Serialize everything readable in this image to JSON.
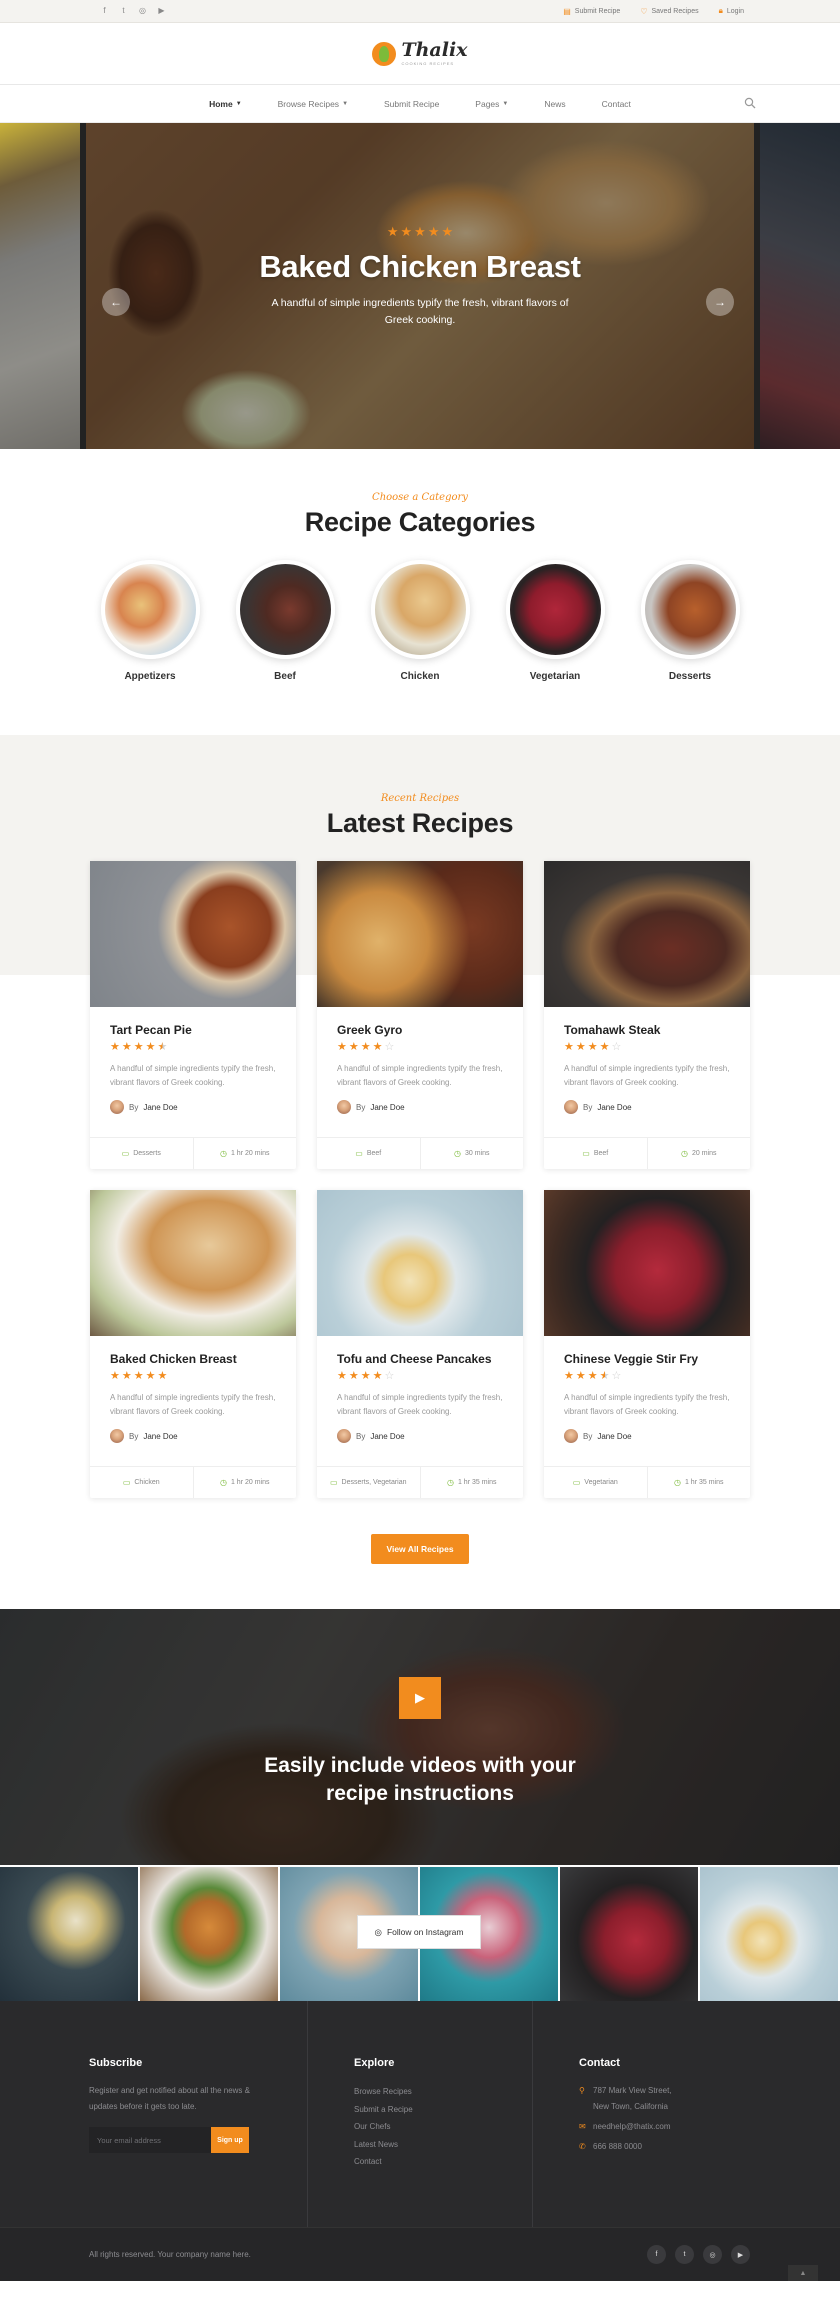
{
  "topbar": {
    "social_icons": [
      "facebook-icon",
      "twitter-icon",
      "instagram-icon",
      "youtube-icon"
    ],
    "submit_recipe": "Submit Recipe",
    "saved_recipes": "Saved Recipes",
    "login": "Login"
  },
  "brand": {
    "name": "Thalix",
    "tagline": "COOKING RECIPES"
  },
  "nav": {
    "items": [
      "Home",
      "Browse Recipes",
      "Submit Recipe",
      "Pages",
      "News",
      "Contact"
    ],
    "active": "Home"
  },
  "hero": {
    "rating": 5,
    "title": "Baked Chicken Breast",
    "description": "A handful of simple ingredients typify the fresh, vibrant flavors of Greek cooking."
  },
  "categories": {
    "eyebrow": "Choose a Category",
    "title": "Recipe Categories",
    "items": [
      {
        "label": "Appetizers"
      },
      {
        "label": "Beef"
      },
      {
        "label": "Chicken"
      },
      {
        "label": "Vegetarian"
      },
      {
        "label": "Desserts"
      }
    ]
  },
  "recipes": {
    "eyebrow": "Recent Recipes",
    "title": "Latest Recipes",
    "by": "By",
    "cards": [
      {
        "title": "Tart Pecan Pie",
        "rating": 4.5,
        "desc": "A handful of simple ingredients typify the fresh, vibrant flavors of Greek cooking.",
        "author": "Jane Doe",
        "category": "Desserts",
        "time": "1 hr 20 mins"
      },
      {
        "title": "Greek Gyro",
        "rating": 4,
        "desc": "A handful of simple ingredients typify the fresh, vibrant flavors of Greek cooking.",
        "author": "Jane Doe",
        "category": "Beef",
        "time": "30 mins"
      },
      {
        "title": "Tomahawk Steak",
        "rating": 4,
        "desc": "A handful of simple ingredients typify the fresh, vibrant flavors of Greek cooking.",
        "author": "Jane Doe",
        "category": "Beef",
        "time": "20 mins"
      },
      {
        "title": "Baked Chicken Breast",
        "rating": 5,
        "desc": "A handful of simple ingredients typify the fresh, vibrant flavors of Greek cooking.",
        "author": "Jane Doe",
        "category": "Chicken",
        "time": "1 hr 20 mins"
      },
      {
        "title": "Tofu and Cheese Pancakes",
        "rating": 4,
        "desc": "A handful of simple ingredients typify the fresh, vibrant flavors of Greek cooking.",
        "author": "Jane Doe",
        "category": "Desserts, Vegetarian",
        "time": "1 hr 35 mins"
      },
      {
        "title": "Chinese Veggie Stir Fry",
        "rating": 3.5,
        "desc": "A handful of simple ingredients typify the fresh, vibrant flavors of Greek cooking.",
        "author": "Jane Doe",
        "category": "Vegetarian",
        "time": "1 hr 35 mins"
      }
    ],
    "view_all": "View All Recipes"
  },
  "video": {
    "title_line1": "Easily include videos with your",
    "title_line2": "recipe instructions"
  },
  "instagram": {
    "follow": "Follow on Instagram"
  },
  "footer": {
    "subscribe": {
      "title": "Subscribe",
      "text": "Register and get notified about all the news & updates before it gets too late.",
      "placeholder": "Your email address",
      "button": "Sign up"
    },
    "explore": {
      "title": "Explore",
      "links": [
        "Browse Recipes",
        "Submit a Recipe",
        "Our Chefs",
        "Latest News",
        "Contact"
      ]
    },
    "contact": {
      "title": "Contact",
      "address_line1": "787 Mark View Street,",
      "address_line2": "New Town, California",
      "email": "needhelp@thatix.com",
      "phone": "666 888 0000"
    },
    "copyright": "All rights reserved. Your company name here."
  },
  "colors": {
    "accent": "#f28c1e",
    "green": "#7cbb3a",
    "footer_bg": "#2a2a2c"
  }
}
